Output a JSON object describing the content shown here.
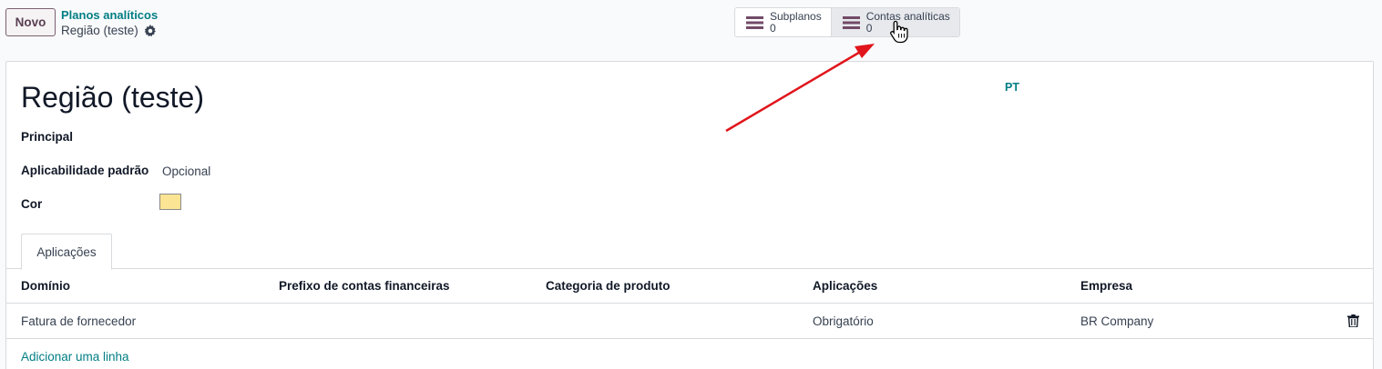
{
  "control_panel": {
    "new_button_label": "Novo",
    "breadcrumb_parent": "Planos analíticos",
    "breadcrumb_current": "Região (teste)",
    "smart_buttons": [
      {
        "label": "Subplanos",
        "count": "0",
        "icon": "list-icon"
      },
      {
        "label": "Contas analíticas",
        "count": "0",
        "icon": "list-icon"
      }
    ]
  },
  "form": {
    "title": "Região (teste)",
    "language_badge": "PT",
    "fields": {
      "principal_label": "Principal",
      "applicability_label": "Aplicabilidade padrão",
      "applicability_value": "Opcional",
      "color_label": "Cor",
      "color_value": "#fbe493"
    },
    "tabs": [
      {
        "label": "Aplicações",
        "active": true
      }
    ],
    "table": {
      "headers": [
        "Domínio",
        "Prefixo de contas financeiras",
        "Categoria de produto",
        "Aplicações",
        "Empresa"
      ],
      "rows": [
        {
          "domain": "Fatura de fornecedor",
          "prefix": "",
          "category": "",
          "applicability": "Obrigatório",
          "company": "BR Company"
        }
      ],
      "add_line_label": "Adicionar uma linha"
    }
  },
  "colors": {
    "accent": "#017e84",
    "brand": "#714b67",
    "annotation_arrow": "#e0151b"
  }
}
